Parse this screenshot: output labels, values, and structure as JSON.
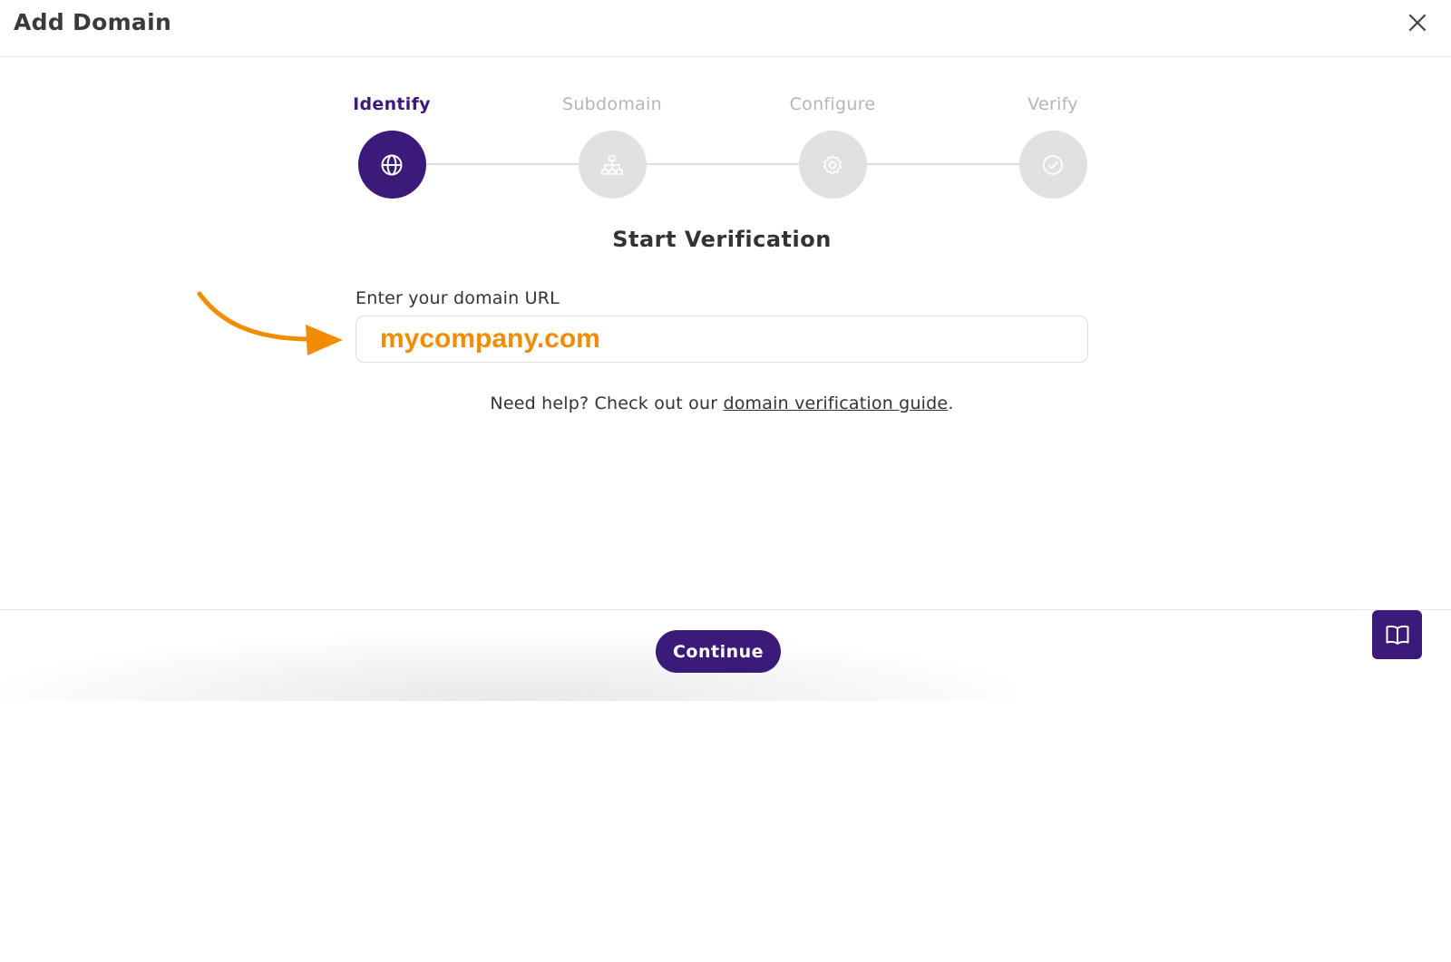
{
  "header": {
    "title": "Add Domain",
    "close_icon": "close-icon"
  },
  "stepper": {
    "steps": [
      {
        "label": "Identify",
        "icon": "globe-icon",
        "active": true
      },
      {
        "label": "Subdomain",
        "icon": "sitemap-icon",
        "active": false
      },
      {
        "label": "Configure",
        "icon": "gear-icon",
        "active": false
      },
      {
        "label": "Verify",
        "icon": "check-circle-icon",
        "active": false
      }
    ]
  },
  "main": {
    "section_title": "Start Verification",
    "field_label": "Enter your domain URL",
    "domain_value": "mycompany.com",
    "help_prefix": "Need help? Check out our ",
    "help_link": "domain verification guide",
    "help_suffix": "."
  },
  "footer": {
    "continue_label": "Continue",
    "help_icon": "book-icon"
  },
  "colors": {
    "brand": "#3b1a7a",
    "annotation": "#f28c00",
    "inactive_step": "#e1e1e1"
  }
}
